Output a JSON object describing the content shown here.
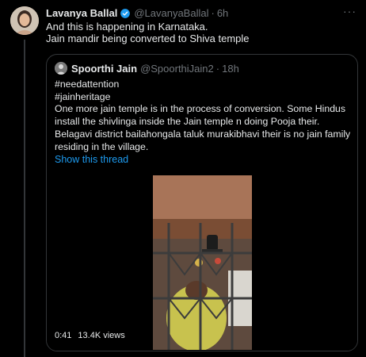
{
  "tweet": {
    "author_name": "Lavanya Ballal",
    "handle": "@LavanyaBallal",
    "separator": "·",
    "time": "6h",
    "lines": [
      "And this is happening in Karnataka.",
      "Jain mandir being converted to Shiva temple"
    ],
    "more_icon": "···"
  },
  "quote": {
    "author_name": "Spoorthi Jain",
    "handle": "@SpoorthiJain2",
    "separator": "·",
    "time": "18h",
    "lines": [
      "#needattention",
      "#jainheritage",
      "One more jain temple is in the process of conversion. Some Hindus",
      "install the shivlinga inside the Jain temple n doing Pooja their.",
      "Belagavi district bailahongala taluk murakibhavi their is no jain family",
      "residing in the village."
    ],
    "show_thread": "Show this thread",
    "video": {
      "duration": "0:41",
      "views": "13.4K views"
    }
  },
  "colors": {
    "background": "#000000",
    "text": "#e7e9ea",
    "muted": "#71767b",
    "link": "#1d9bf0",
    "border": "#333639",
    "verified": "#1d9bf0"
  }
}
